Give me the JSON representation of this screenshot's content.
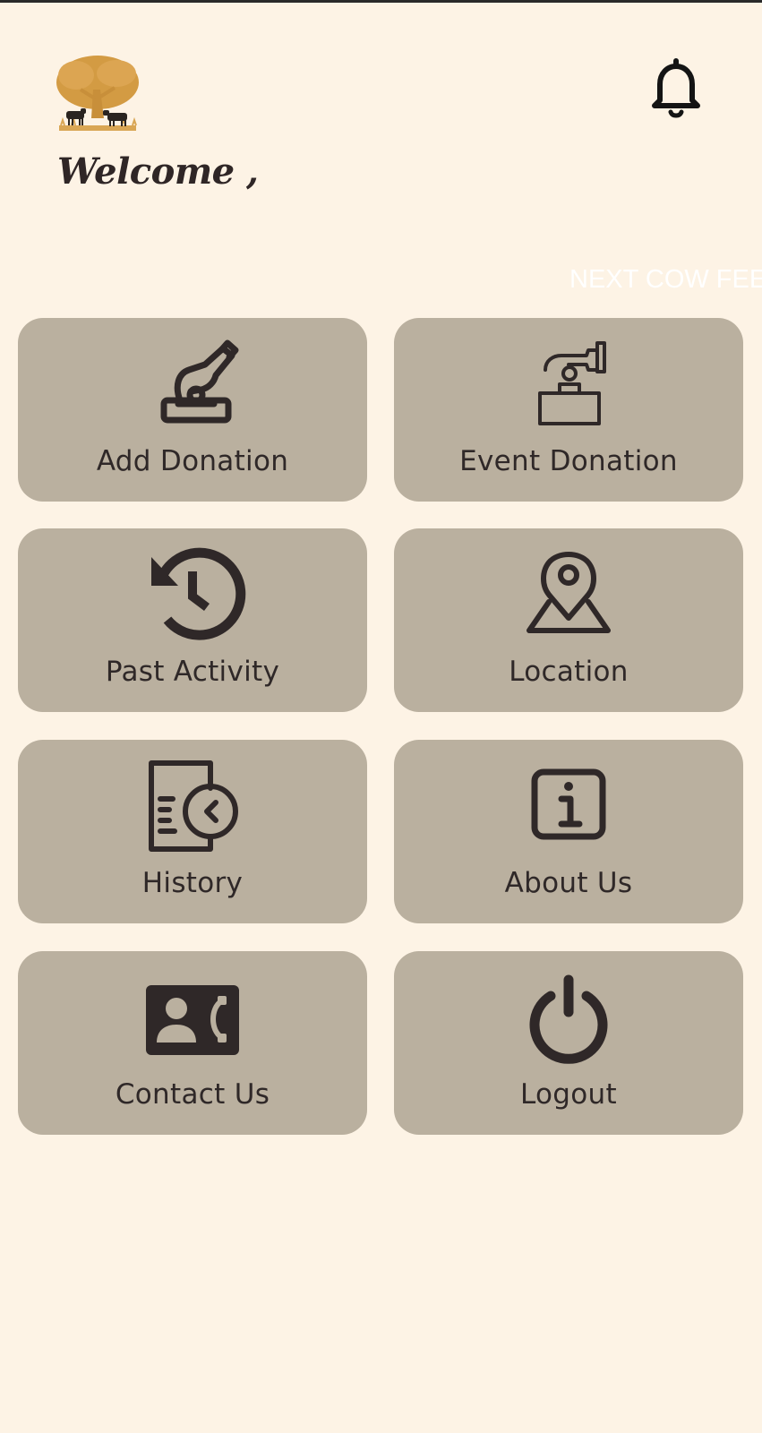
{
  "header": {
    "welcome_text": "Welcome ,",
    "logo_icon": "tree-with-cows-logo",
    "notification_icon": "bell-icon"
  },
  "marquee": {
    "text": "NEXT COW FEE"
  },
  "menu": {
    "items": [
      {
        "label": "Add Donation",
        "icon": "hand-donation-box-icon"
      },
      {
        "label": "Event Donation",
        "icon": "event-donation-icon"
      },
      {
        "label": "Past Activity",
        "icon": "history-clock-icon"
      },
      {
        "label": "Location",
        "icon": "location-pin-icon"
      },
      {
        "label": "History",
        "icon": "document-clock-icon"
      },
      {
        "label": "About Us",
        "icon": "info-icon"
      },
      {
        "label": "Contact Us",
        "icon": "contact-card-icon"
      },
      {
        "label": "Logout",
        "icon": "power-icon"
      }
    ]
  },
  "colors": {
    "background": "#fdf3e5",
    "tile": "#bab09f",
    "text": "#2f2828",
    "logo": "#d39b43"
  }
}
